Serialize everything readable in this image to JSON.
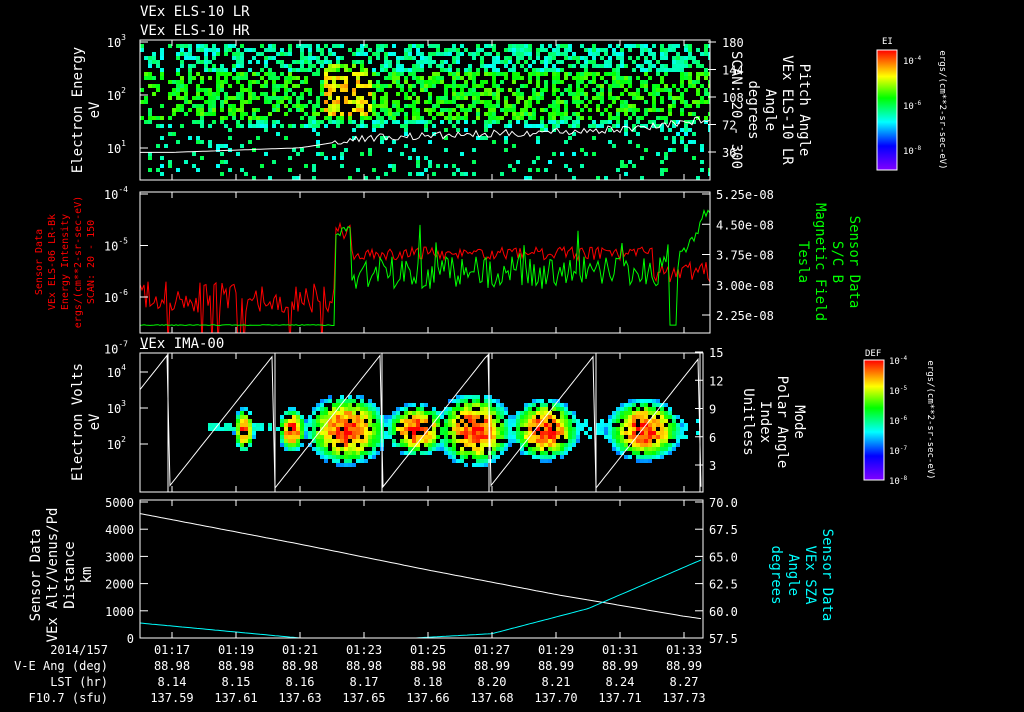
{
  "titles": [
    "VEx ELS-10 LR",
    "VEx ELS-10 HR"
  ],
  "panel3_title": "VEx IMA-00",
  "colors": {
    "background": "#000000",
    "axes": "#ffffff",
    "red": "#ff0000",
    "green": "#00ff00",
    "cyan": "#00ffff"
  },
  "chart_data": [
    {
      "type": "heatmap",
      "name": "ELS electron spectrogram",
      "ylabel": [
        "Electron Energy",
        "eV"
      ],
      "yticks": [
        "10",
        "10",
        "10"
      ],
      "ytick_exps": [
        "3",
        "2",
        "1"
      ],
      "ylim": [
        3,
        1000
      ],
      "right_label": [
        "Pitch Angle",
        "VEx ELS-10 LR",
        "Angle",
        "degrees",
        "SCAN: 20 - 300"
      ],
      "right_ticks": [
        "180",
        "144",
        "108",
        "72",
        "36"
      ],
      "right_ylim": [
        0,
        180
      ],
      "colorbar": {
        "title": "EI",
        "ticks": [
          "10",
          "10",
          "10"
        ],
        "tick_exps": [
          "-4",
          "-6",
          "-8"
        ],
        "unit": "ergs/(cm**2-sr-sec-eV)"
      },
      "pitch_angle_line": {
        "x": [
          "01:17",
          "01:21",
          "01:23",
          "01:27",
          "01:31",
          "01:34"
        ],
        "y": [
          36,
          42,
          55,
          60,
          66,
          80
        ]
      }
    },
    {
      "type": "line",
      "name": "Energy intensity and magnetic field",
      "left_label": [
        "Sensor Data",
        "VEx ELS-06 LR-Bk",
        "Energy Intensity",
        "ergs/(cm**2-sr-sec-eV)",
        "SCAN: 20 - 150"
      ],
      "left_ticks": [
        "10",
        "10",
        "10",
        "10"
      ],
      "left_tick_exps": [
        "-4",
        "-5",
        "-6",
        "-7"
      ],
      "ylim": [
        1e-08,
        0.0001
      ],
      "right_label": [
        "Sensor Data",
        "S/C B",
        "Magnetic Field",
        "Tesla"
      ],
      "right_ticks": [
        "5.25e-08",
        "4.50e-08",
        "3.75e-08",
        "3.00e-08",
        "2.25e-08"
      ],
      "right_ylim": [
        1.75e-08,
        5.25e-08
      ],
      "series": [
        {
          "name": "Energy Intensity",
          "color": "#ff0000",
          "x": [
            "01:17",
            "01:20",
            "01:22",
            "01:22.5",
            "01:25",
            "01:30",
            "01:34"
          ],
          "y": [
            1e-06,
            8e-07,
            1e-06,
            2e-05,
            7e-06,
            6e-06,
            2e-06
          ]
        },
        {
          "name": "Magnetic Field",
          "color": "#00ff00",
          "x": [
            "01:17",
            "01:20",
            "01:22",
            "01:22.5",
            "01:25",
            "01:30",
            "01:33",
            "01:34"
          ],
          "y": [
            2e-08,
            1.95e-08,
            2e-08,
            4.4e-08,
            3.3e-08,
            3.5e-08,
            3.3e-08,
            5e-08
          ]
        }
      ]
    },
    {
      "type": "heatmap",
      "name": "IMA ion spectrogram",
      "ylabel": [
        "Electron Volts",
        "eV"
      ],
      "yticks": [
        "10",
        "10",
        "10"
      ],
      "ytick_exps": [
        "4",
        "3",
        "2"
      ],
      "ylim": [
        10,
        30000
      ],
      "right_label": [
        "Mode",
        "Polar Angle",
        "Index",
        "Unitless"
      ],
      "right_ticks": [
        "15",
        "12",
        "9",
        "6",
        "3"
      ],
      "right_ylim": [
        0,
        15
      ],
      "colorbar": {
        "title": "DEF",
        "ticks": [
          "10",
          "10",
          "10",
          "10",
          "10"
        ],
        "tick_exps": [
          "-4",
          "-5",
          "-6",
          "-7",
          "-8"
        ],
        "unit": "ergs/(cm**2-sr-sec-eV)"
      }
    },
    {
      "type": "line",
      "name": "Altitude and SZA",
      "left_label": [
        "Sensor Data",
        "VEx Alt/Venus/Pd",
        "Distance",
        "km"
      ],
      "left_ticks": [
        "5000",
        "4000",
        "3000",
        "2000",
        "1000",
        "0"
      ],
      "ylim": [
        0,
        5000
      ],
      "right_label": [
        "Sensor Data",
        "VEx SZA",
        "Angle",
        "degrees"
      ],
      "right_ticks": [
        "70.0",
        "67.5",
        "65.0",
        "62.5",
        "60.0",
        "57.5"
      ],
      "right_ylim": [
        57.5,
        70.0
      ],
      "series": [
        {
          "name": "Altitude",
          "color": "#ffffff",
          "x": [
            "01:17",
            "01:21",
            "01:25",
            "01:29",
            "01:33",
            "01:34.5"
          ],
          "y": [
            4350,
            3450,
            2500,
            1600,
            800,
            550
          ]
        },
        {
          "name": "SZA",
          "color": "#00ffff",
          "x": [
            "01:17",
            "01:21",
            "01:24",
            "01:27",
            "01:30",
            "01:33",
            "01:34.5"
          ],
          "y": [
            58.6,
            57.5,
            57.4,
            57.9,
            60.2,
            64.0,
            65.9
          ]
        }
      ]
    }
  ],
  "time_axis": {
    "row_labels": [
      "2014/157",
      "V-E Ang (deg)",
      "LST (hr)",
      "F10.7 (sfu)"
    ],
    "times": [
      "01:17",
      "01:19",
      "01:21",
      "01:23",
      "01:25",
      "01:27",
      "01:29",
      "01:31",
      "01:33"
    ],
    "ve_ang": [
      "88.98",
      "88.98",
      "88.98",
      "88.98",
      "88.98",
      "88.99",
      "88.99",
      "88.99",
      "88.99"
    ],
    "lst": [
      "8.14",
      "8.15",
      "8.16",
      "8.17",
      "8.18",
      "8.20",
      "8.21",
      "8.24",
      "8.27"
    ],
    "f107": [
      "137.59",
      "137.61",
      "137.63",
      "137.65",
      "137.66",
      "137.68",
      "137.70",
      "137.71",
      "137.73"
    ]
  }
}
